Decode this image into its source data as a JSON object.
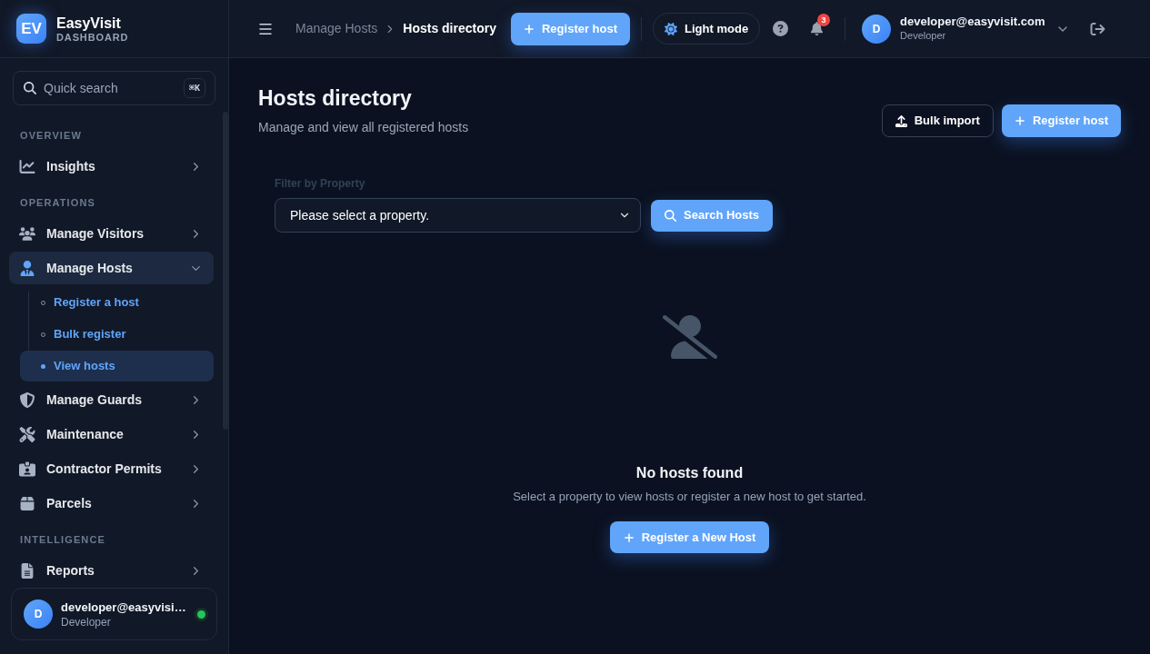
{
  "sidebar": {
    "brand": {
      "logo": "EV",
      "name": "EasyVisit",
      "tagline": "DASHBOARD"
    },
    "search": {
      "placeholder": "Quick search",
      "shortcut": "⌘K"
    },
    "sections": [
      {
        "title": "OVERVIEW",
        "items": [
          {
            "label": "Insights",
            "selected": false,
            "expanded": false
          }
        ]
      },
      {
        "title": "OPERATIONS",
        "items": [
          {
            "label": "Manage Visitors",
            "selected": false,
            "expanded": false
          },
          {
            "label": "Manage Hosts",
            "selected": true,
            "expanded": true,
            "children": [
              {
                "label": "Register a host",
                "selected": false
              },
              {
                "label": "Bulk register",
                "selected": false
              },
              {
                "label": "View hosts",
                "selected": true
              }
            ]
          },
          {
            "label": "Manage Guards",
            "selected": false,
            "expanded": false
          },
          {
            "label": "Maintenance",
            "selected": false,
            "expanded": false
          },
          {
            "label": "Contractor Permits",
            "selected": false,
            "expanded": false
          },
          {
            "label": "Parcels",
            "selected": false,
            "expanded": false
          }
        ]
      },
      {
        "title": "INTELLIGENCE",
        "items": [
          {
            "label": "Reports",
            "selected": false,
            "expanded": false
          }
        ]
      }
    ],
    "user": {
      "avatar": "D",
      "name": "developer@easyvisi…",
      "role": "Developer",
      "online": true
    }
  },
  "header": {
    "breadcrumb": [
      {
        "label": "Manage Hosts",
        "current": false
      },
      {
        "label": "Hosts directory",
        "current": true
      }
    ],
    "primary_button": "Register host",
    "theme_toggle": "Light mode",
    "notifications": "3",
    "user": {
      "avatar": "D",
      "email": "developer@easyvisit.com",
      "role": "Developer"
    }
  },
  "page": {
    "title": "Hosts directory",
    "subtitle": "Manage and view all registered hosts",
    "actions": [
      {
        "label": "Bulk import",
        "kind": "outline"
      },
      {
        "label": "Register host",
        "kind": "primary"
      }
    ],
    "filter": {
      "label": "Filter by Property",
      "value": "Please select a property.",
      "button": "Search Hosts"
    },
    "empty_state": {
      "title": "No hosts found",
      "message": "Select a property to view hosts or register a new host to get started.",
      "button": "Register a New Host"
    }
  }
}
